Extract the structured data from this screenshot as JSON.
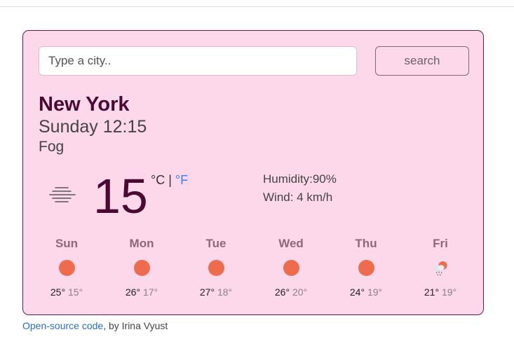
{
  "search": {
    "placeholder": "Type a city..",
    "value": "",
    "button_label": "search"
  },
  "current": {
    "city": "New York",
    "datetime": "Sunday 12:15",
    "condition": "Fog",
    "icon": "fog-icon",
    "temperature": "15",
    "unit_celsius": "°C",
    "unit_separator": "|",
    "unit_fahrenheit": "°F",
    "humidity": "Humidity:90%",
    "wind": "Wind: 4 km/h"
  },
  "forecast": [
    {
      "day": "Sun",
      "icon": "sun-icon",
      "max": "25°",
      "min": "15°"
    },
    {
      "day": "Mon",
      "icon": "sun-icon",
      "max": "26°",
      "min": "17°"
    },
    {
      "day": "Tue",
      "icon": "sun-icon",
      "max": "27°",
      "min": "18°"
    },
    {
      "day": "Wed",
      "icon": "sun-icon",
      "max": "26°",
      "min": "20°"
    },
    {
      "day": "Thu",
      "icon": "sun-icon",
      "max": "24°",
      "min": "19°"
    },
    {
      "day": "Fri",
      "icon": "rain-cloud-icon",
      "max": "21°",
      "min": "19°"
    }
  ],
  "footer": {
    "link_text": "Open-source code",
    "credit": ", by Irina Vyust"
  },
  "colors": {
    "card_background": "#fdd8ea",
    "card_border": "#6b1a48",
    "accent_dark": "#4a0a33",
    "sun": "#ee6c4d",
    "link": "#2a6fc9",
    "fahrenheit_link": "#3b82f6"
  }
}
